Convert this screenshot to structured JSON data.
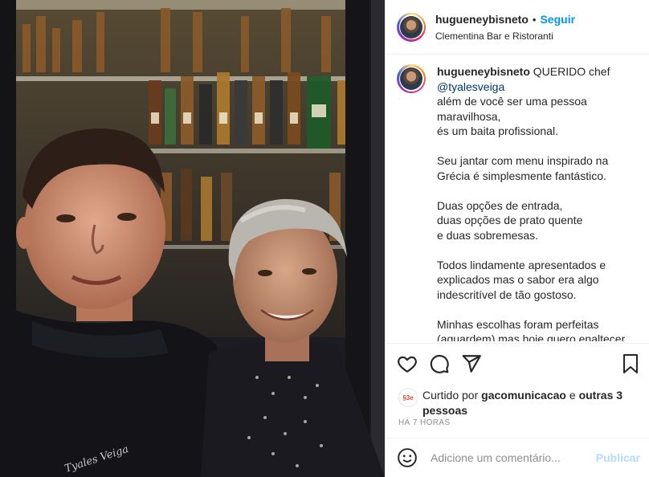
{
  "post": {
    "username": "hugueneybisneto",
    "separator": "•",
    "follow_label": "Seguir",
    "location": "Clementina Bar e Ristoranti",
    "photo_embroidery": "Tyales Veiga"
  },
  "caption": {
    "username": "hugueneybisneto",
    "first_line": "QUERIDO chef",
    "mention": "@tyalesveiga",
    "paragraphs": [
      "além de você ser uma pessoa\nmaravilhosa,\nés um baita profissional.",
      "Seu jantar com menu inspirado na\nGrécia é simplesmente fantástico.",
      "Duas opções de entrada,\nduas opções de prato quente\ne duas sobremesas.",
      "Todos lindamente apresentados e\nexplicados mas o sabor era algo\nindescritível de tão gostoso.",
      "Minhas escolhas foram perfeitas\n(aguardem) mas hoje quero enaltecer"
    ]
  },
  "likes": {
    "avatar_text": "§3e",
    "prefix": "Curtido por",
    "user": "gacomunicacao",
    "middle": "e",
    "others": "outras 3 pessoas"
  },
  "timestamp": "HÁ 7 HORAS",
  "comment": {
    "placeholder": "Adicione um comentário...",
    "publish_label": "Publicar"
  },
  "icons": {
    "like": "heart-icon",
    "comment": "comment-icon",
    "share": "share-icon",
    "save": "bookmark-icon",
    "emoji": "emoji-icon"
  },
  "colors": {
    "accent": "#0095f6",
    "mention": "#00376b",
    "publish_disabled": "#b3dbff",
    "muted": "#8e8e8e"
  }
}
